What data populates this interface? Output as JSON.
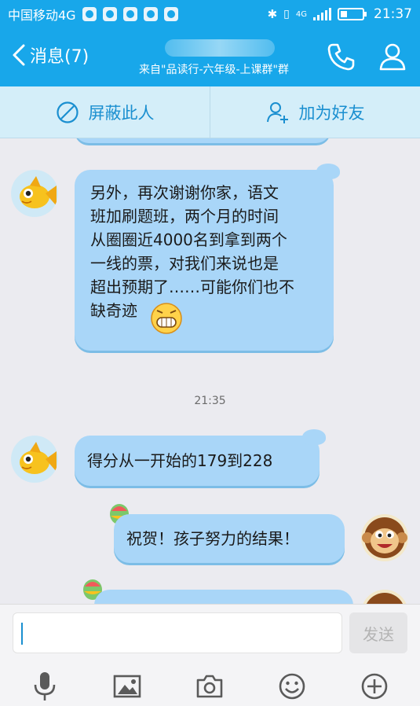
{
  "status_bar": {
    "carrier": "中国移动4G",
    "network": "4G",
    "time": "21:37"
  },
  "header": {
    "back_label": "消息(7)",
    "subtitle": "来自\"品读行-六年级-上课群\"群"
  },
  "actions": {
    "block": "屏蔽此人",
    "add_friend": "加为好友"
  },
  "messages": [
    {
      "text": "另外，再次谢谢你家，语文\n班加刷题班，两个月的时间\n从圈圈近4000名到拿到两个\n一线的票，对我们来说也是\n超出预期了……可能你们也不\n缺奇迹"
    },
    {
      "text": "得分从一开始的179到228"
    },
    {
      "text": "祝贺！孩子努力的结果！"
    }
  ],
  "timestamp": "21:35",
  "input": {
    "send_label": "发送"
  },
  "colors": {
    "brand": "#18a7ea",
    "bubble": "#a9d6f8",
    "action_bar": "#d4eef9"
  },
  "icons": {
    "call": "phone-icon",
    "profile": "person-icon",
    "block": "block-icon",
    "add_friend": "add-friend-icon",
    "voice": "microphone-icon",
    "image": "image-icon",
    "camera": "camera-icon",
    "emoji": "emoji-icon",
    "more": "plus-icon"
  }
}
